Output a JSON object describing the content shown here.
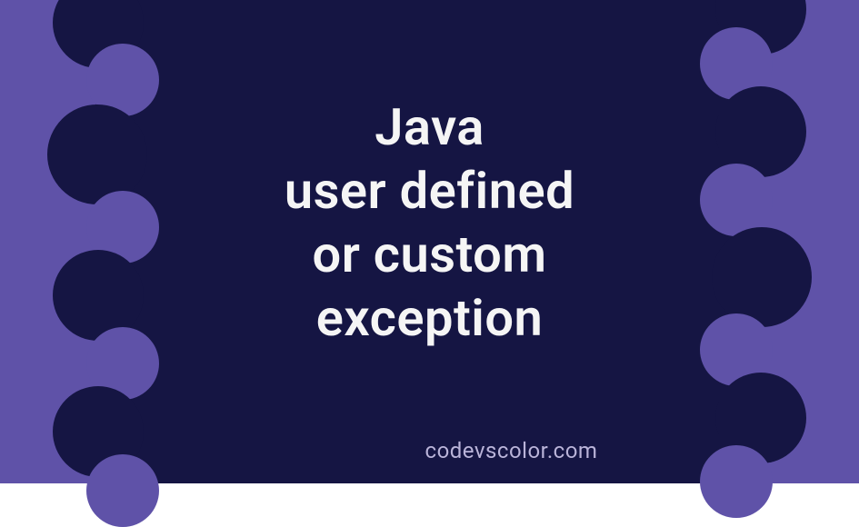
{
  "title": {
    "line1": "Java",
    "line2": "user defined",
    "line3": "or custom",
    "line4": "exception"
  },
  "watermark": "codevscolor.com",
  "colors": {
    "background_light": "#5f52a8",
    "background_dark": "#151543",
    "text": "#f5f5f5",
    "watermark": "#bab4d9"
  }
}
